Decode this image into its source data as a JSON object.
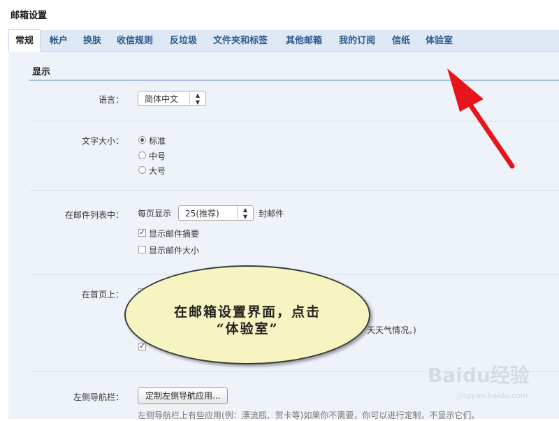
{
  "page": {
    "title": "邮箱设置"
  },
  "tabs": [
    {
      "label": "常规",
      "active": true
    },
    {
      "label": "帐户"
    },
    {
      "label": "换肤"
    },
    {
      "label": "收信规则"
    },
    {
      "label": "反垃圾"
    },
    {
      "label": "文件夹和标签"
    },
    {
      "label": "其他邮箱"
    },
    {
      "label": "我的订阅"
    },
    {
      "label": "信纸"
    },
    {
      "label": "体验室"
    }
  ],
  "display_section": {
    "title": "显示",
    "language": {
      "label": "语言：",
      "value": "简体中文"
    },
    "font_size": {
      "label": "文字大小：",
      "options": [
        {
          "label": "标准",
          "checked": true
        },
        {
          "label": "中号",
          "checked": false
        },
        {
          "label": "大号",
          "checked": false
        }
      ]
    },
    "mail_list": {
      "label": "在邮件列表中：",
      "per_page_prefix": "每页显示",
      "per_page_value": "25(推荐)",
      "per_page_suffix": "封邮件",
      "show_summary": {
        "label": "显示邮件摘要",
        "checked": true
      },
      "show_size": {
        "label": "显示邮件大小",
        "checked": false
      }
    },
    "home_page": {
      "label": "在首页上：",
      "weather_fragment": "天天气情况。)"
    },
    "left_nav": {
      "label": "左侧导航栏：",
      "button_label": "定制左侧导航应用...",
      "help_text": "左侧导航栏上有些应用(例：漂流瓶、贺卡等)如果你不需要，你可以进行定制，不显示它们。"
    }
  },
  "annotation": {
    "line1": "在邮箱设置界面，点击",
    "line2": "“体验室”",
    "arrow_color": "#e8141b",
    "bubble_color": "#f6f5c2"
  },
  "watermark": {
    "logo": "Baidu经验",
    "url": "jingyan.baidu.com"
  }
}
